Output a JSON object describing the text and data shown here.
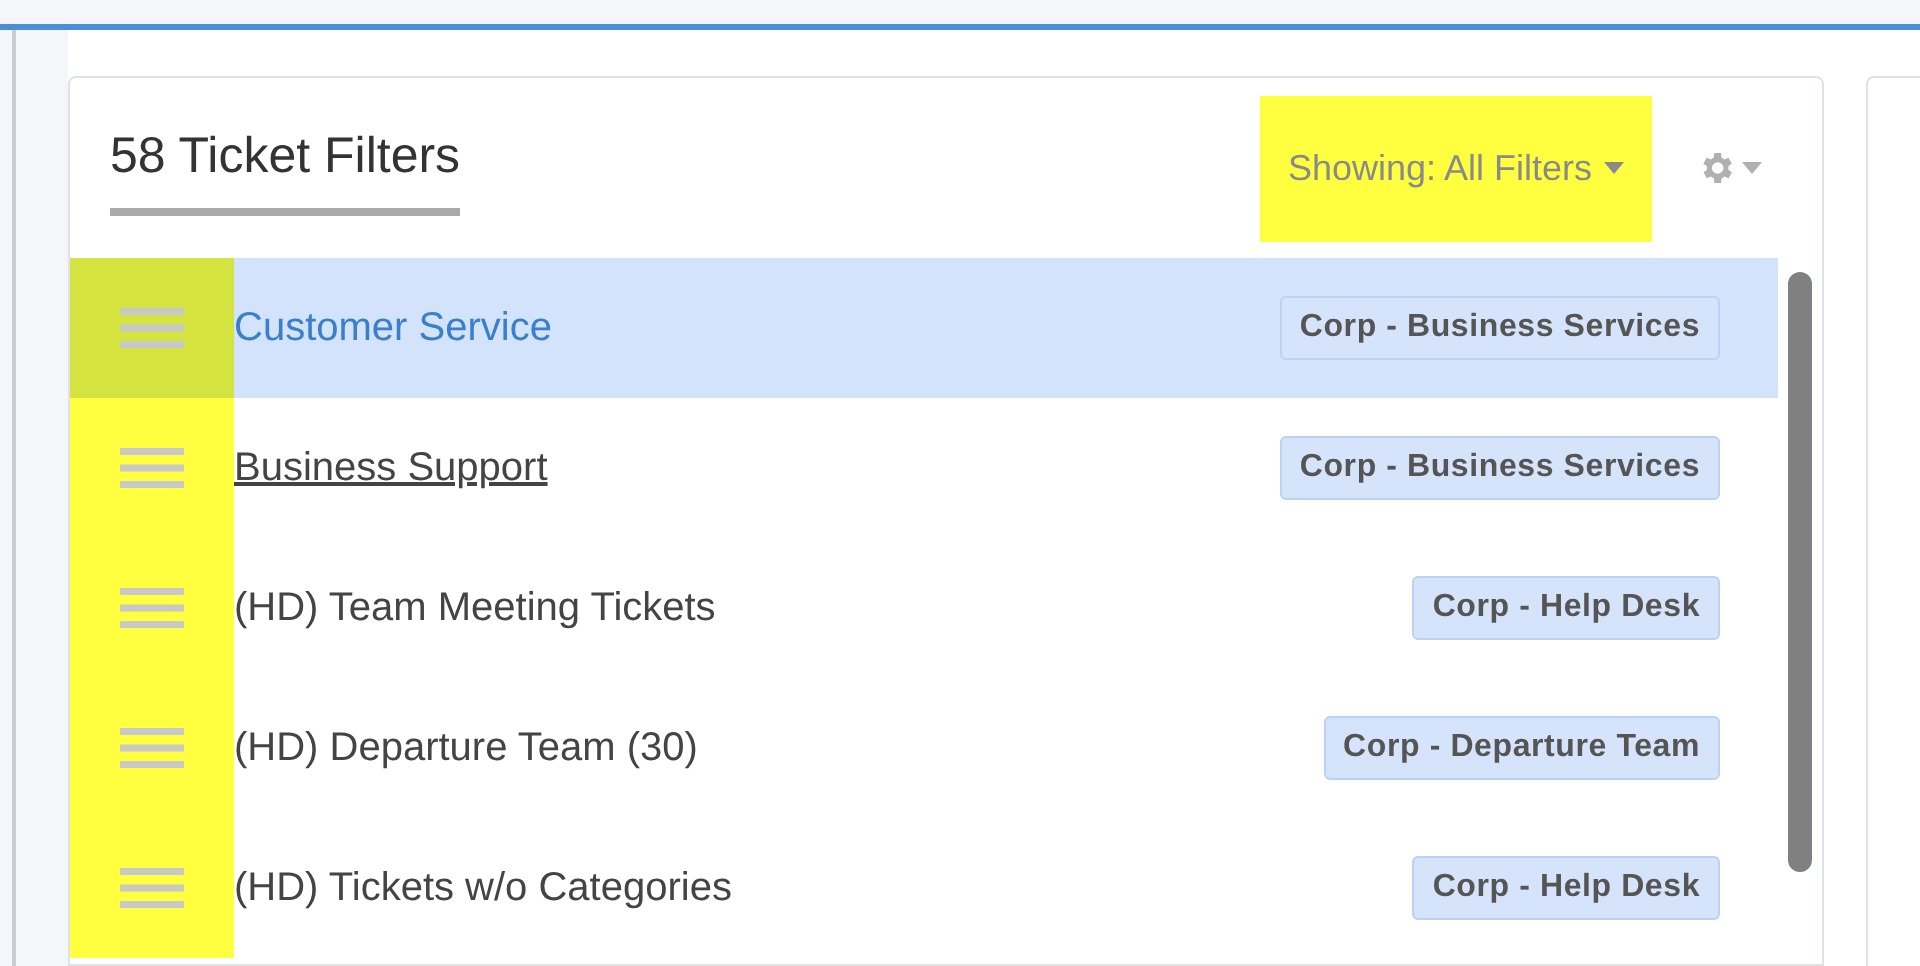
{
  "panel": {
    "title": "58 Ticket Filters",
    "showing_menu": {
      "label": "Showing: All Filters",
      "highlighted": true
    }
  },
  "filters": [
    {
      "name": "Customer Service",
      "tag": "Corp - Business Services",
      "selected": true,
      "hovered": false
    },
    {
      "name": "Business Support",
      "tag": "Corp - Business Services",
      "selected": false,
      "hovered": true
    },
    {
      "name": "(HD) Team Meeting Tickets",
      "tag": "Corp - Help Desk",
      "selected": false,
      "hovered": false
    },
    {
      "name": "(HD) Departure Team (30)",
      "tag": "Corp - Departure Team",
      "selected": false,
      "hovered": false
    },
    {
      "name": "(HD) Tickets w/o Categories",
      "tag": "Corp - Help Desk",
      "selected": false,
      "hovered": false
    }
  ],
  "drag_handles_highlighted": true
}
